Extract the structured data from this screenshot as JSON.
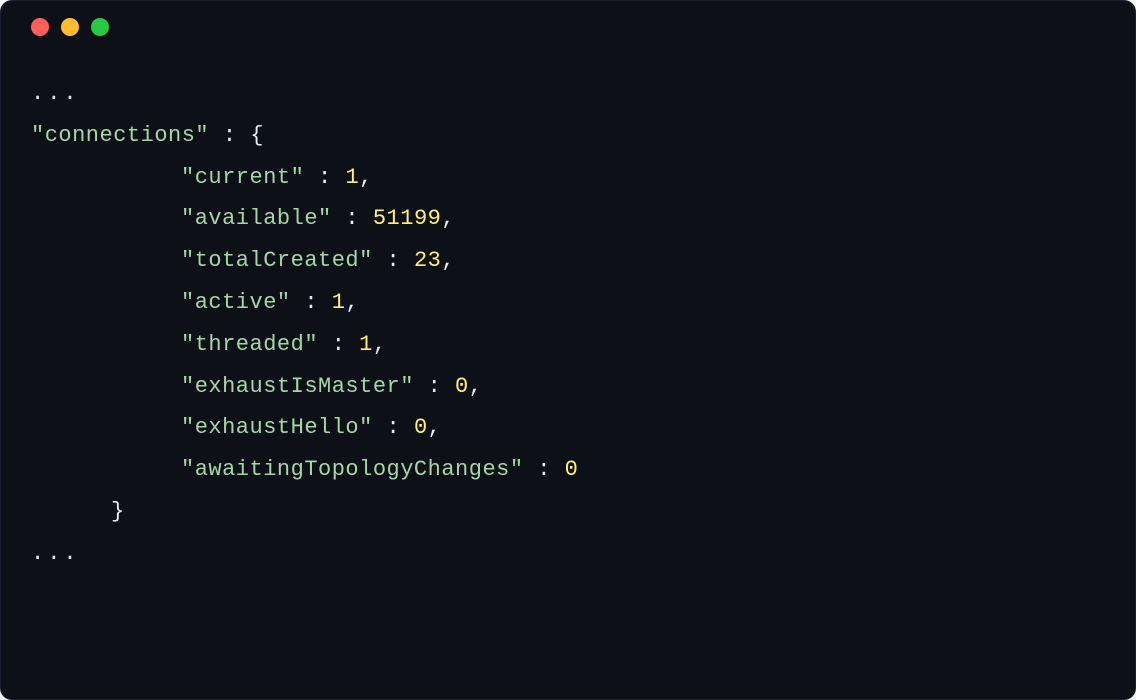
{
  "ellipsis_top": "...",
  "ellipsis_bottom": "...",
  "root_key": "\"connections\"",
  "open_brace": " : {",
  "close_brace": "}",
  "entries": [
    {
      "key": "\"current\"",
      "sep": " : ",
      "val": "1",
      "trail": ","
    },
    {
      "key": "\"available\"",
      "sep": " : ",
      "val": "51199",
      "trail": ","
    },
    {
      "key": "\"totalCreated\"",
      "sep": " : ",
      "val": "23",
      "trail": ","
    },
    {
      "key": "\"active\"",
      "sep": " : ",
      "val": "1",
      "trail": ","
    },
    {
      "key": "\"threaded\"",
      "sep": " : ",
      "val": "1",
      "trail": ","
    },
    {
      "key": "\"exhaustIsMaster\"",
      "sep": " : ",
      "val": "0",
      "trail": ","
    },
    {
      "key": "\"exhaustHello\"",
      "sep": " : ",
      "val": "0",
      "trail": ","
    },
    {
      "key": "\"awaitingTopologyChanges\"",
      "sep": " : ",
      "val": "0",
      "trail": ""
    }
  ]
}
